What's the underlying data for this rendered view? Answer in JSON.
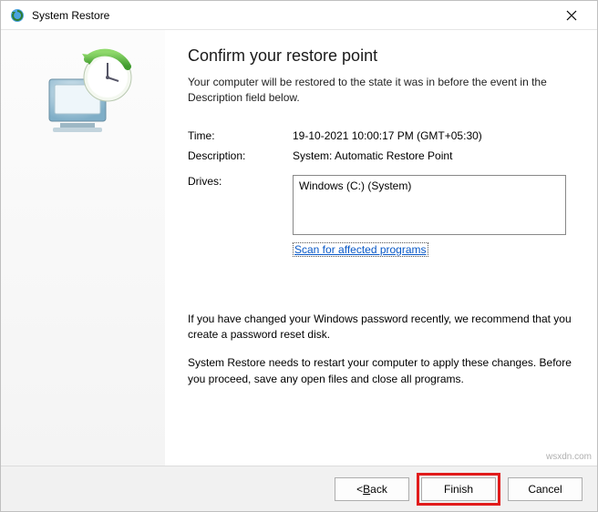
{
  "window": {
    "title": "System Restore"
  },
  "heading": "Confirm your restore point",
  "intro": "Your computer will be restored to the state it was in before the event in the Description field below.",
  "fields": {
    "time_label": "Time:",
    "time_value": "19-10-2021 10:00:17 PM (GMT+05:30)",
    "desc_label": "Description:",
    "desc_value": "System: Automatic Restore Point",
    "drives_label": "Drives:",
    "drives_value": "Windows (C:) (System)"
  },
  "scan_link": "Scan for affected programs",
  "note_password": "If you have changed your Windows password recently, we recommend that you create a password reset disk.",
  "note_restart": "System Restore needs to restart your computer to apply these changes. Before you proceed, save any open files and close all programs.",
  "buttons": {
    "back_prefix": "< ",
    "back_letter": "B",
    "back_rest": "ack",
    "finish": "Finish",
    "cancel": "Cancel"
  },
  "watermark": "wsxdn.com"
}
